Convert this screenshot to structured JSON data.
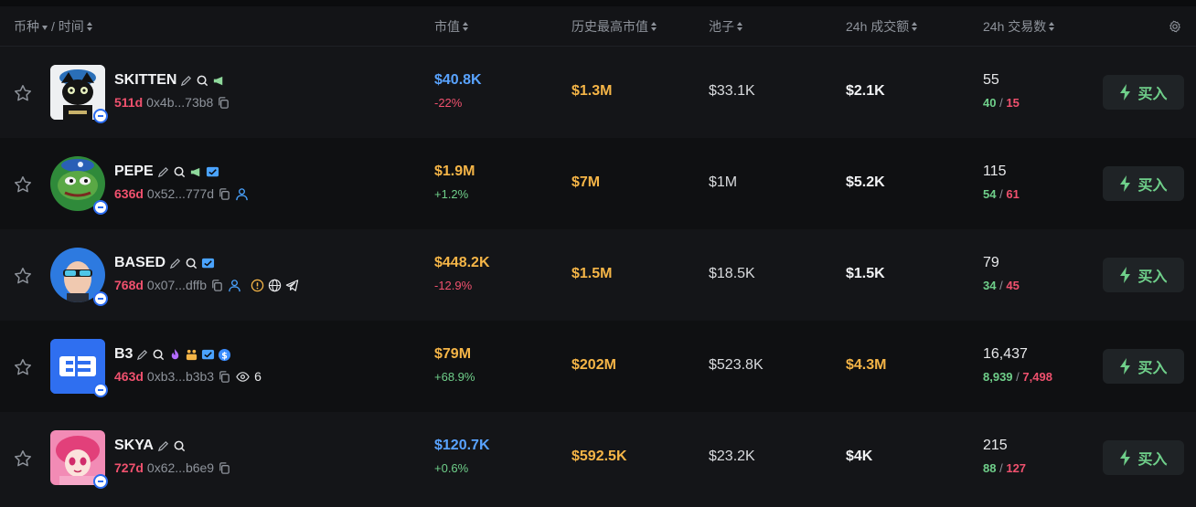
{
  "header": {
    "token_label": "币种",
    "time_label": "/ 时间",
    "market_cap": "市值",
    "ath_mc": "历史最高市值",
    "pool": "池子",
    "volume_24h": "24h 成交额",
    "txs_24h": "24h 交易数"
  },
  "colors": {
    "green": "#6fcf8a",
    "red": "#f0516e",
    "gold": "#f5b547",
    "blue": "#59a3ff"
  },
  "rows": [
    {
      "name": "SKITTEN",
      "age": "511d",
      "address": "0x4b...73b8",
      "holders": "",
      "mc": "$40.8K",
      "mc_color": "blue",
      "change": "-22%",
      "change_dir": "down",
      "ath": "$1.3M",
      "pool": "$33.1K",
      "volume": "$2.1K",
      "volume_color": "white",
      "txs": "55",
      "buys": "40",
      "sells": "15",
      "buy_label": "买入",
      "avatar": "skitten"
    },
    {
      "name": "PEPE",
      "age": "636d",
      "address": "0x52...777d",
      "holders": "",
      "mc": "$1.9M",
      "mc_color": "gold",
      "change": "+1.2%",
      "change_dir": "up",
      "ath": "$7M",
      "pool": "$1M",
      "volume": "$5.2K",
      "volume_color": "white",
      "txs": "115",
      "buys": "54",
      "sells": "61",
      "buy_label": "买入",
      "avatar": "pepe"
    },
    {
      "name": "BASED",
      "age": "768d",
      "address": "0x07...dffb",
      "holders": "",
      "mc": "$448.2K",
      "mc_color": "gold",
      "change": "-12.9%",
      "change_dir": "down",
      "ath": "$1.5M",
      "pool": "$18.5K",
      "volume": "$1.5K",
      "volume_color": "white",
      "txs": "79",
      "buys": "34",
      "sells": "45",
      "buy_label": "买入",
      "avatar": "based"
    },
    {
      "name": "B3",
      "age": "463d",
      "address": "0xb3...b3b3",
      "holders": "6",
      "mc": "$79M",
      "mc_color": "gold",
      "change": "+68.9%",
      "change_dir": "up",
      "ath": "$202M",
      "pool": "$523.8K",
      "volume": "$4.3M",
      "volume_color": "gold",
      "txs": "16,437",
      "buys": "8,939",
      "sells": "7,498",
      "buy_label": "买入",
      "avatar": "b3"
    },
    {
      "name": "SKYA",
      "age": "727d",
      "address": "0x62...b6e9",
      "holders": "",
      "mc": "$120.7K",
      "mc_color": "blue",
      "change": "+0.6%",
      "change_dir": "up",
      "ath": "$592.5K",
      "pool": "$23.2K",
      "volume": "$4K",
      "volume_color": "white",
      "txs": "215",
      "buys": "88",
      "sells": "127",
      "buy_label": "买入",
      "avatar": "skya"
    }
  ]
}
